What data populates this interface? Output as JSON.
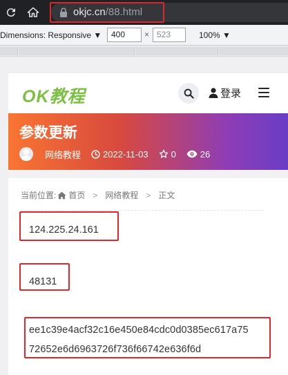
{
  "browser": {
    "url_host": "okjc.cn",
    "url_path": "/88.html"
  },
  "devtools": {
    "dimensions_label": "Dimensions: Responsive ▼",
    "width_value": "400",
    "times": "×",
    "height_value": "523",
    "zoom_label": "100% ▼"
  },
  "site": {
    "logo": "OK教程",
    "login_label": "登录"
  },
  "article": {
    "title": "参数更新",
    "category": "网络教程",
    "date": "2022-11-03",
    "stars": "0",
    "views": "26"
  },
  "breadcrumb": {
    "prefix": "当前位置:",
    "home": "首页",
    "sep1": ">",
    "category": "网络教程",
    "sep2": ">",
    "current": "正文"
  },
  "content": {
    "ip": "124.225.24.161",
    "port": "48131",
    "hash_line1": "ee1c39e4acf32c16e450e84cdc0d0385ec617a75",
    "hash_line2": "72652e6d6963726f736f66742e636f6d"
  },
  "colors": {
    "annotation": "#e0262b",
    "logo": "#7bc043",
    "hero_start": "#f97532",
    "hero_end": "#6a3dc6"
  }
}
